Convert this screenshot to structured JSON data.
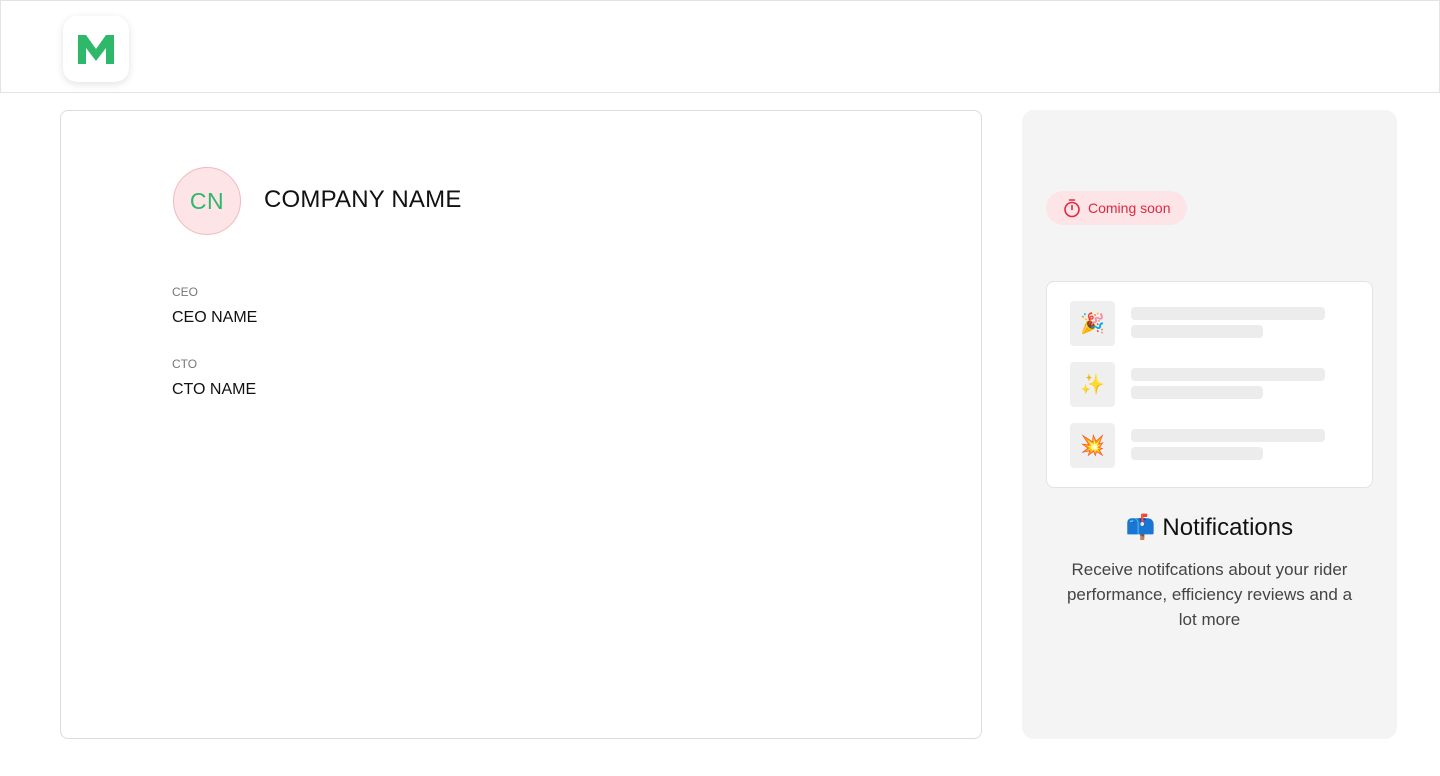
{
  "header": {
    "logo_letter": "M",
    "logo_color": "#2db86a"
  },
  "company": {
    "initials": "CN",
    "name": "COMPANY NAME",
    "fields": [
      {
        "label": "CEO",
        "value": "CEO NAME"
      },
      {
        "label": "CTO",
        "value": "CTO NAME"
      }
    ]
  },
  "side_panel": {
    "badge_icon": "stopwatch-icon",
    "badge_label": "Coming soon",
    "preview_items": [
      {
        "icon": "party-popper-icon",
        "emoji": "🎉"
      },
      {
        "icon": "sparkles-icon",
        "emoji": "✨"
      },
      {
        "icon": "collision-icon",
        "emoji": "💥"
      }
    ],
    "title_emoji": "📫",
    "title": "Notifications",
    "description": "Receive notifcations about your rider performance, efficiency reviews and a lot more"
  },
  "colors": {
    "accent_green": "#2db86a",
    "accent_red": "#e0283f",
    "pink_bg": "#fde4e7",
    "panel_bg": "#f4f4f4"
  }
}
